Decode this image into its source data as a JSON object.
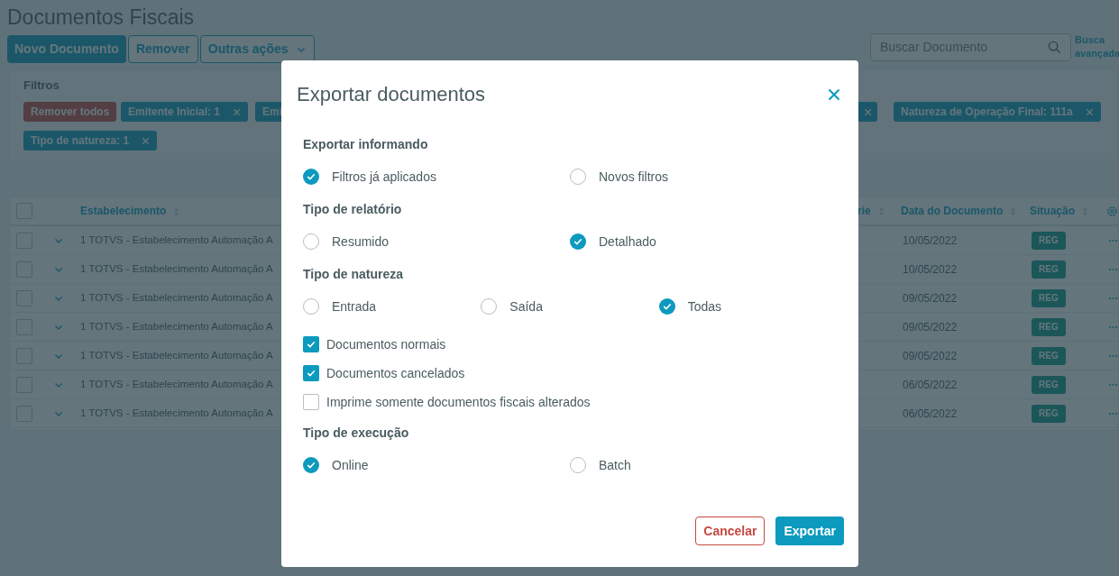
{
  "page": {
    "title": "Documentos Fiscais",
    "actions": [
      {
        "label": "Novo Documento",
        "kind": "primary"
      },
      {
        "label": "Remover",
        "kind": "outline"
      },
      {
        "label": "Outras ações",
        "kind": "dropdown"
      }
    ],
    "search": {
      "placeholder": "Buscar Documento"
    },
    "advanced_search": "Busca avançada"
  },
  "filters": {
    "title": "Filtros",
    "chips": [
      {
        "label": "Remover todos",
        "kind": "clear"
      },
      {
        "label": "Emitente Inicial: 1",
        "kind": "filter"
      },
      {
        "label": "Emi",
        "kind": "partial"
      },
      {
        "kind": "closeonly"
      },
      {
        "label": "Natureza de Operação Final: 111a",
        "kind": "filter"
      },
      {
        "label": "Tipo de natureza: 1",
        "kind": "filter"
      }
    ]
  },
  "table": {
    "header_checked": false,
    "columns": [
      "Estabelecimento",
      "rie",
      "Data do Documento",
      "Situação"
    ],
    "rows": [
      {
        "checked": false,
        "establishment": "1 TOTVS - Estabelecimento Automação A",
        "date": "10/05/2022",
        "status": "REG"
      },
      {
        "checked": false,
        "establishment": "1 TOTVS - Estabelecimento Automação A",
        "date": "10/05/2022",
        "status": "REG"
      },
      {
        "checked": false,
        "establishment": "1 TOTVS - Estabelecimento Automação A",
        "date": "09/05/2022",
        "status": "REG"
      },
      {
        "checked": false,
        "establishment": "1 TOTVS - Estabelecimento Automação A",
        "date": "09/05/2022",
        "status": "REG"
      },
      {
        "checked": false,
        "establishment": "1 TOTVS - Estabelecimento Automação A",
        "date": "09/05/2022",
        "status": "REG"
      },
      {
        "checked": false,
        "establishment": "1 TOTVS - Estabelecimento Automação A",
        "date": "06/05/2022",
        "status": "REG"
      },
      {
        "checked": false,
        "establishment": "1 TOTVS - Estabelecimento Automação A",
        "date": "06/05/2022",
        "status": "REG"
      }
    ]
  },
  "modal": {
    "title": "Exportar documentos",
    "sections": [
      {
        "heading": "Exportar informando",
        "kind": "radio",
        "options": [
          {
            "label": "Filtros já aplicados",
            "selected": true
          },
          {
            "label": "Novos filtros",
            "selected": false
          }
        ]
      },
      {
        "heading": "Tipo de relatório",
        "kind": "radio",
        "options": [
          {
            "label": "Resumido",
            "selected": false
          },
          {
            "label": "Detalhado",
            "selected": true
          }
        ]
      },
      {
        "heading": "Tipo de natureza",
        "kind": "radio",
        "options": [
          {
            "label": "Entrada",
            "selected": false
          },
          {
            "label": "Saída",
            "selected": false
          },
          {
            "label": "Todas",
            "selected": true
          }
        ]
      },
      {
        "kind": "checkbox",
        "options": [
          {
            "label": "Documentos normais",
            "checked": true
          },
          {
            "label": "Documentos cancelados",
            "checked": true
          },
          {
            "label": "Imprime somente documentos fiscais alterados",
            "checked": false
          }
        ]
      },
      {
        "heading": "Tipo de execução",
        "kind": "radio",
        "options": [
          {
            "label": "Online",
            "selected": true
          },
          {
            "label": "Batch",
            "selected": false
          }
        ]
      }
    ],
    "buttons": [
      {
        "label": "Cancelar",
        "kind": "secondary"
      },
      {
        "label": "Exportar",
        "kind": "primary"
      }
    ]
  }
}
